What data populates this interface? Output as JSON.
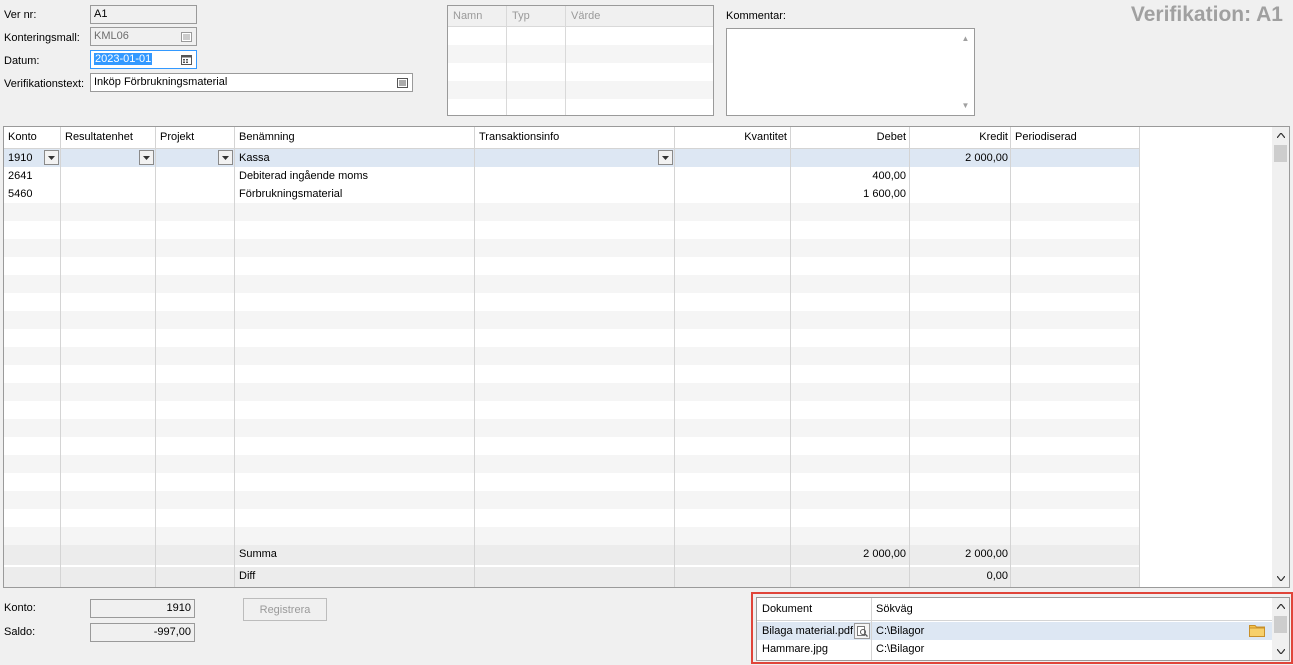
{
  "header": {
    "ver_nr_label": "Ver nr:",
    "ver_nr_value": "A1",
    "konteringsmall_label": "Konteringsmall:",
    "konteringsmall_value": "KML06",
    "datum_label": "Datum:",
    "datum_value": "2023-01-01",
    "verifikationstext_label": "Verifikationstext:",
    "verifikationstext_value": "Inköp Förbrukningsmaterial",
    "kommentar_label": "Kommentar:",
    "kommentar_value": "",
    "page_title": "Verifikation: A1"
  },
  "properties": {
    "columns": [
      "Namn",
      "Typ",
      "Värde"
    ]
  },
  "grid": {
    "columns": [
      "Konto",
      "Resultatenhet",
      "Projekt",
      "Benämning",
      "Transaktionsinfo",
      "Kvantitet",
      "Debet",
      "Kredit",
      "Periodiserad"
    ],
    "rows": [
      {
        "konto": "1910",
        "resultatenhet": "",
        "projekt": "",
        "benamning": "Kassa",
        "transaktionsinfo": "",
        "kvantitet": "",
        "debet": "",
        "kredit": "2 000,00",
        "periodiserad": ""
      },
      {
        "konto": "2641",
        "resultatenhet": "",
        "projekt": "",
        "benamning": "Debiterad ingående moms",
        "transaktionsinfo": "",
        "kvantitet": "",
        "debet": "400,00",
        "kredit": "",
        "periodiserad": ""
      },
      {
        "konto": "5460",
        "resultatenhet": "",
        "projekt": "",
        "benamning": "Förbrukningsmaterial",
        "transaktionsinfo": "",
        "kvantitet": "",
        "debet": "1 600,00",
        "kredit": "",
        "periodiserad": ""
      }
    ],
    "summa_label": "Summa",
    "summa_debet": "2 000,00",
    "summa_kredit": "2 000,00",
    "diff_label": "Diff",
    "diff_kredit": "0,00"
  },
  "footer": {
    "konto_label": "Konto:",
    "konto_value": "1910",
    "saldo_label": "Saldo:",
    "saldo_value": "-997,00",
    "register_button": "Registrera"
  },
  "documents": {
    "columns": [
      "Dokument",
      "Sökväg"
    ],
    "rows": [
      {
        "dokument": "Bilaga material.pdf",
        "sokvag": "C:\\Bilagor"
      },
      {
        "dokument": "Hammare.jpg",
        "sokvag": "C:\\Bilagor"
      }
    ]
  },
  "icons": {
    "picker": "list-picker-icon",
    "calendar": "calendar-icon",
    "dropdown": "chevron-down-icon",
    "preview": "magnifier-icon",
    "folder": "folder-icon",
    "scroll_up": "scroll-up-icon",
    "scroll_down": "scroll-down-icon"
  },
  "colors": {
    "selected_row": "#dde7f3",
    "highlight_border": "#e0453a",
    "date_selection": "#3399ff"
  }
}
